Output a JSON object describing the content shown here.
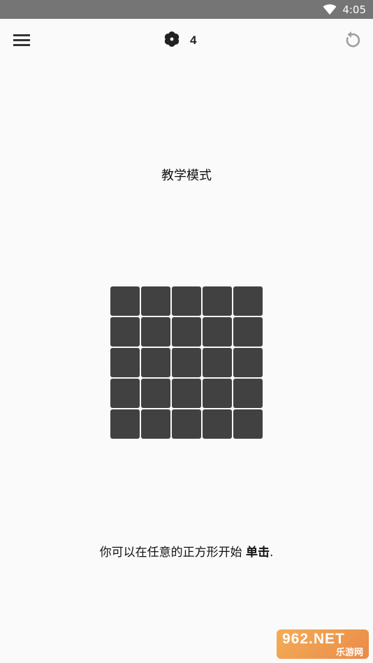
{
  "status_bar": {
    "time": "4:05",
    "wifi_icon": "wifi-icon"
  },
  "app_bar": {
    "menu_icon": "hamburger-menu-icon",
    "hint_icon": "hint-flower-icon",
    "hint_count": "4",
    "reset_icon": "reset-icon"
  },
  "main": {
    "title": "教学模式",
    "grid": {
      "rows": 5,
      "cols": 5,
      "cell_color": "#414141"
    },
    "instruction": {
      "text": "你可以在任意的正方形开始 ",
      "bold": "单击",
      "suffix": "."
    }
  },
  "watermark": {
    "logo_text": "962.NET",
    "sub_text": "乐游网"
  },
  "colors": {
    "status_bar": "#757575",
    "background": "#fafafa",
    "cell": "#414141"
  }
}
